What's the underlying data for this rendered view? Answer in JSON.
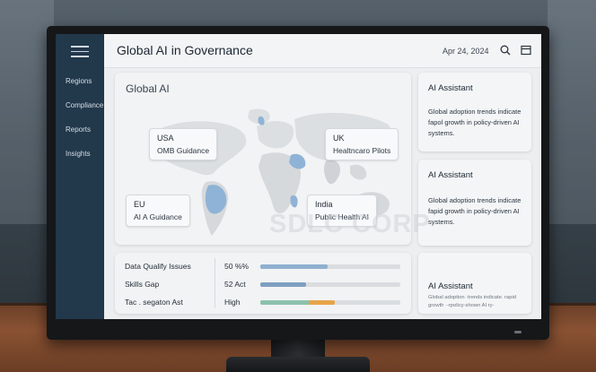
{
  "app": {
    "title": "Global AI in Governance",
    "date": "Apr 24, 2024",
    "watermark": "SDLC CORP"
  },
  "sidebar": {
    "items": [
      {
        "label": "Regions"
      },
      {
        "label": "Compliance"
      },
      {
        "label": "Reports"
      },
      {
        "label": "Insights"
      }
    ]
  },
  "header": {
    "icons": [
      "search-icon",
      "window-icon"
    ]
  },
  "map": {
    "title": "Global AI",
    "callouts": [
      {
        "region": "USA",
        "text": "OMB Guidance"
      },
      {
        "region": "UK",
        "text": "Healtncaro Pilots"
      },
      {
        "region": "EU",
        "text": "AI A Guidance"
      },
      {
        "region": "India",
        "text": "Public Health AI"
      }
    ],
    "highlight_color": "#8fb3d6"
  },
  "metrics": [
    {
      "label": "Data Qualify Issues",
      "value": "50 %%",
      "bar_fraction": 0.48,
      "bar_colors": [
        "#8fb0cf"
      ]
    },
    {
      "label": "Skills Gap",
      "value": "52 Act",
      "bar_fraction": 0.33,
      "bar_colors": [
        "#7f9fc0"
      ]
    },
    {
      "label": "Tac . segaton Ast",
      "value": "High",
      "bar_fraction": 0.53,
      "bar_colors": [
        "#8cc1ae",
        "#e7a44a"
      ]
    }
  ],
  "assistant": [
    {
      "title": "AI Assistant",
      "body": "Global adoption trends indicate fapol growth in policy-driven AI systems."
    },
    {
      "title": "AI Assistant",
      "body": "Global adoption trends indicate fapid growth in policy-driven AI systems."
    },
    {
      "title": "AI Assistant",
      "body": "Global adoption ·trends indicate. rapid growth ·-rpolicy-shown AI ry-"
    }
  ]
}
